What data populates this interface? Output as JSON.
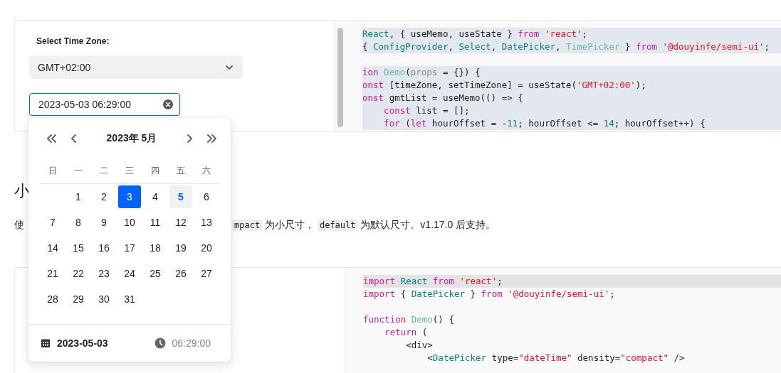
{
  "demo1": {
    "label": "Select Time Zone:",
    "select": {
      "value": "GMT+02:00"
    },
    "input": {
      "value": "2023-05-03 06:29:00"
    },
    "code": [
      {
        "kind": "code",
        "tokens": [
          {
            "kind": "type",
            "t": "React"
          },
          {
            "kind": "plain",
            "t": ", { useMemo, useState } "
          },
          {
            "kind": "kw",
            "t": "from "
          },
          {
            "kind": "str",
            "t": "'react'"
          },
          {
            "kind": "plain",
            "t": ";"
          }
        ]
      },
      {
        "kind": "code",
        "tokens": [
          {
            "kind": "plain",
            "t": "{ "
          },
          {
            "kind": "type",
            "t": "ConfigProvider"
          },
          {
            "kind": "plain",
            "t": ", "
          },
          {
            "kind": "type",
            "t": "Select"
          },
          {
            "kind": "plain",
            "t": ", "
          },
          {
            "kind": "type",
            "t": "DatePicker"
          },
          {
            "kind": "plain",
            "t": ", "
          },
          {
            "kind": "func",
            "t": "TimePicker"
          },
          {
            "kind": "plain",
            "t": " } "
          },
          {
            "kind": "kw",
            "t": "from "
          },
          {
            "kind": "str",
            "t": "'@douyinfe/semi-ui'"
          },
          {
            "kind": "plain",
            "t": ";"
          }
        ]
      },
      {
        "kind": "blank"
      },
      {
        "kind": "code",
        "tokens": [
          {
            "kind": "kw",
            "t": "ion "
          },
          {
            "kind": "func",
            "t": "Demo"
          },
          {
            "kind": "plain",
            "t": "("
          },
          {
            "kind": "faded",
            "t": "props"
          },
          {
            "kind": "plain",
            "t": " = {}) {"
          }
        ]
      },
      {
        "kind": "code",
        "tokens": [
          {
            "kind": "kw",
            "t": "onst"
          },
          {
            "kind": "plain",
            "t": " [timeZone, setTimeZone] = useState("
          },
          {
            "kind": "str",
            "t": "'GMT+02:00'"
          },
          {
            "kind": "plain",
            "t": ");"
          }
        ]
      },
      {
        "kind": "code",
        "tokens": [
          {
            "kind": "kw",
            "t": "onst"
          },
          {
            "kind": "plain",
            "t": " gmtList = useMemo(() => {"
          }
        ]
      },
      {
        "kind": "code",
        "tokens": [
          {
            "kind": "kw",
            "t": "    const"
          },
          {
            "kind": "plain",
            "t": " list = [];"
          }
        ]
      },
      {
        "kind": "code",
        "tokens": [
          {
            "kind": "kw",
            "t": "    for"
          },
          {
            "kind": "plain",
            "t": " ("
          },
          {
            "kind": "kw",
            "t": "let"
          },
          {
            "kind": "plain",
            "t": " hourOffset = -"
          },
          {
            "kind": "num",
            "t": "11"
          },
          {
            "kind": "plain",
            "t": "; hourOffset <= "
          },
          {
            "kind": "num",
            "t": "14"
          },
          {
            "kind": "plain",
            "t": "; hourOffset++) {"
          }
        ]
      }
    ]
  },
  "calendar": {
    "title": "2023年 5月",
    "weekdays": [
      "日",
      "一",
      "二",
      "三",
      "四",
      "五",
      "六"
    ],
    "days": [
      {
        "kind": "blank"
      },
      {
        "kind": "day",
        "day": "1",
        "selected": false,
        "today": false
      },
      {
        "kind": "day",
        "day": "2",
        "selected": false,
        "today": false
      },
      {
        "kind": "day",
        "day": "3",
        "selected": true,
        "today": false
      },
      {
        "kind": "day",
        "day": "4",
        "selected": false,
        "today": false
      },
      {
        "kind": "day",
        "day": "5",
        "selected": false,
        "today": true
      },
      {
        "kind": "day",
        "day": "6",
        "selected": false,
        "today": false
      },
      {
        "kind": "day",
        "day": "7",
        "selected": false,
        "today": false
      },
      {
        "kind": "day",
        "day": "8",
        "selected": false,
        "today": false
      },
      {
        "kind": "day",
        "day": "9",
        "selected": false,
        "today": false
      },
      {
        "kind": "day",
        "day": "10",
        "selected": false,
        "today": false
      },
      {
        "kind": "day",
        "day": "11",
        "selected": false,
        "today": false
      },
      {
        "kind": "day",
        "day": "12",
        "selected": false,
        "today": false
      },
      {
        "kind": "day",
        "day": "13",
        "selected": false,
        "today": false
      },
      {
        "kind": "day",
        "day": "14",
        "selected": false,
        "today": false
      },
      {
        "kind": "day",
        "day": "15",
        "selected": false,
        "today": false
      },
      {
        "kind": "day",
        "day": "16",
        "selected": false,
        "today": false
      },
      {
        "kind": "day",
        "day": "17",
        "selected": false,
        "today": false
      },
      {
        "kind": "day",
        "day": "18",
        "selected": false,
        "today": false
      },
      {
        "kind": "day",
        "day": "19",
        "selected": false,
        "today": false
      },
      {
        "kind": "day",
        "day": "20",
        "selected": false,
        "today": false
      },
      {
        "kind": "day",
        "day": "21",
        "selected": false,
        "today": false
      },
      {
        "kind": "day",
        "day": "22",
        "selected": false,
        "today": false
      },
      {
        "kind": "day",
        "day": "23",
        "selected": false,
        "today": false
      },
      {
        "kind": "day",
        "day": "24",
        "selected": false,
        "today": false
      },
      {
        "kind": "day",
        "day": "25",
        "selected": false,
        "today": false
      },
      {
        "kind": "day",
        "day": "26",
        "selected": false,
        "today": false
      },
      {
        "kind": "day",
        "day": "27",
        "selected": false,
        "today": false
      },
      {
        "kind": "day",
        "day": "28",
        "selected": false,
        "today": false
      },
      {
        "kind": "day",
        "day": "29",
        "selected": false,
        "today": false
      },
      {
        "kind": "day",
        "day": "30",
        "selected": false,
        "today": false
      },
      {
        "kind": "day",
        "day": "31",
        "selected": false,
        "today": false
      }
    ],
    "footer_date": "2023-05-03",
    "footer_time": "06:29:00"
  },
  "section": {
    "heading": "小",
    "paragraph_start": "使",
    "paragraph_rest": [
      {
        "code": true,
        "t": "mpact"
      },
      {
        "code": false,
        "t": " 为小尺寸， "
      },
      {
        "code": true,
        "t": "default"
      },
      {
        "code": false,
        "t": " 为默认尺寸。v1.17.0 后支持。"
      }
    ]
  },
  "demo2": {
    "code": [
      {
        "kind": "code",
        "highlight": true,
        "tokens": [
          {
            "kind": "kw",
            "t": "import "
          },
          {
            "kind": "type",
            "t": "React "
          },
          {
            "kind": "kw",
            "t": "from "
          },
          {
            "kind": "str",
            "t": "'react'"
          },
          {
            "kind": "plain",
            "t": ";"
          }
        ]
      },
      {
        "kind": "code",
        "highlight": false,
        "tokens": [
          {
            "kind": "kw",
            "t": "import"
          },
          {
            "kind": "plain",
            "t": " { "
          },
          {
            "kind": "type",
            "t": "DatePicker"
          },
          {
            "kind": "plain",
            "t": " } "
          },
          {
            "kind": "kw",
            "t": "from "
          },
          {
            "kind": "str",
            "t": "'@douyinfe/semi-ui'"
          },
          {
            "kind": "plain",
            "t": ";"
          }
        ]
      },
      {
        "kind": "blank"
      },
      {
        "kind": "code",
        "highlight": false,
        "tokens": [
          {
            "kind": "kw",
            "t": "function "
          },
          {
            "kind": "func",
            "t": "Demo"
          },
          {
            "kind": "plain",
            "t": "() {"
          }
        ]
      },
      {
        "kind": "code",
        "highlight": false,
        "tokens": [
          {
            "kind": "kw",
            "t": "    return"
          },
          {
            "kind": "plain",
            "t": " ("
          }
        ]
      },
      {
        "kind": "code",
        "highlight": false,
        "tokens": [
          {
            "kind": "plain",
            "t": "        <div>"
          }
        ]
      },
      {
        "kind": "code",
        "highlight": false,
        "tokens": [
          {
            "kind": "plain",
            "t": "            <"
          },
          {
            "kind": "type",
            "t": "DatePicker"
          },
          {
            "kind": "plain",
            "t": " type="
          },
          {
            "kind": "str",
            "t": "\"dateTime\""
          },
          {
            "kind": "plain",
            "t": " density="
          },
          {
            "kind": "str",
            "t": "\"compact\""
          },
          {
            "kind": "plain",
            "t": " />"
          }
        ]
      }
    ]
  }
}
